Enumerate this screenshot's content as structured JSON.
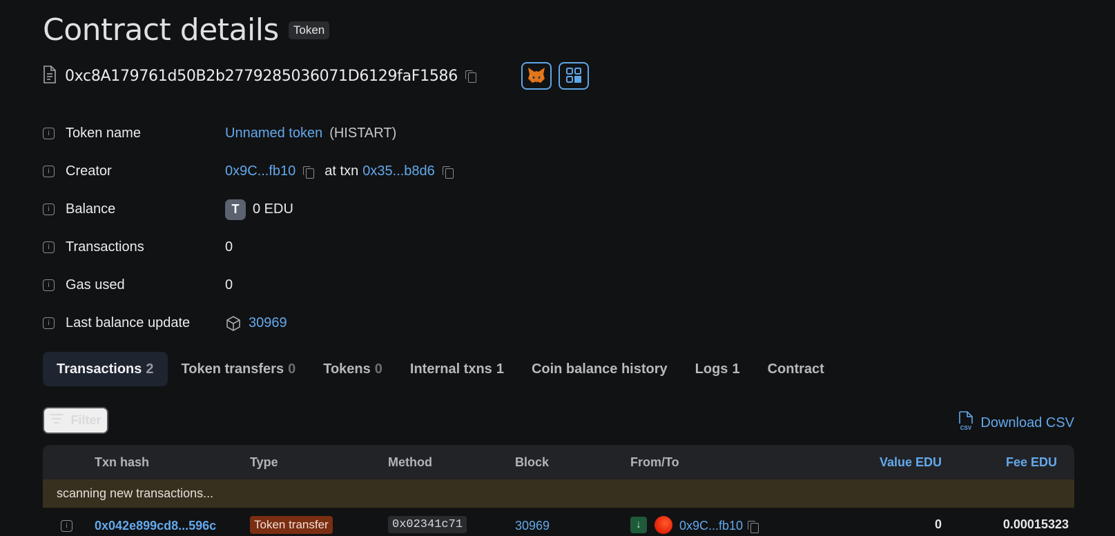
{
  "header": {
    "title": "Contract details",
    "badge": "Token"
  },
  "address": {
    "value": "0xc8A179761d50B2b2779285036071D6129faF1586"
  },
  "details": [
    {
      "label": "Token name",
      "link": "Unnamed token",
      "suffix": "(HISTART)"
    },
    {
      "label": "Creator",
      "creator": "0x9C...fb10",
      "at_txn_label": "at txn",
      "txn": "0x35...b8d6"
    },
    {
      "label": "Balance",
      "avatar_letter": "T",
      "value": "0 EDU"
    },
    {
      "label": "Transactions",
      "value": "0"
    },
    {
      "label": "Gas used",
      "value": "0"
    },
    {
      "label": "Last balance update",
      "block": "30969"
    }
  ],
  "tabs": [
    {
      "label": "Transactions",
      "count": "2",
      "active": true
    },
    {
      "label": "Token transfers",
      "count": "0"
    },
    {
      "label": "Tokens",
      "count": "0"
    },
    {
      "label": "Internal txns",
      "count": "1"
    },
    {
      "label": "Coin balance history",
      "count": ""
    },
    {
      "label": "Logs",
      "count": "1"
    },
    {
      "label": "Contract",
      "count": ""
    }
  ],
  "toolbar": {
    "filter_label": "Filter",
    "csv_label": "Download CSV",
    "csv_icon_text": "CSV"
  },
  "table": {
    "headers": {
      "hash": "Txn hash",
      "type": "Type",
      "method": "Method",
      "block": "Block",
      "fromto": "From/To",
      "value": "Value EDU",
      "fee": "Fee EDU"
    },
    "scanning": "scanning new transactions...",
    "rows": [
      {
        "hash": "0x042e899cd8...596c",
        "type": "Token transfer",
        "method": "0x02341c71",
        "block": "30969",
        "address": "0x9C...fb10",
        "value": "0",
        "fee": "0.00015323"
      }
    ]
  },
  "colors": {
    "background": "#111214",
    "link": "#63a9ec",
    "active_tab": "#1e2430",
    "scan_banner": "#38301f",
    "type_badge": "#7a2e12"
  },
  "icons": {
    "address": "document-icon",
    "copy": "copy-icon",
    "wallet": "metamask-fox-icon",
    "qr": "qr-code-icon",
    "info": "info-icon",
    "block": "cube-icon",
    "filter": "filter-icon",
    "csv": "csv-file-icon",
    "direction": "arrow-down-icon"
  }
}
